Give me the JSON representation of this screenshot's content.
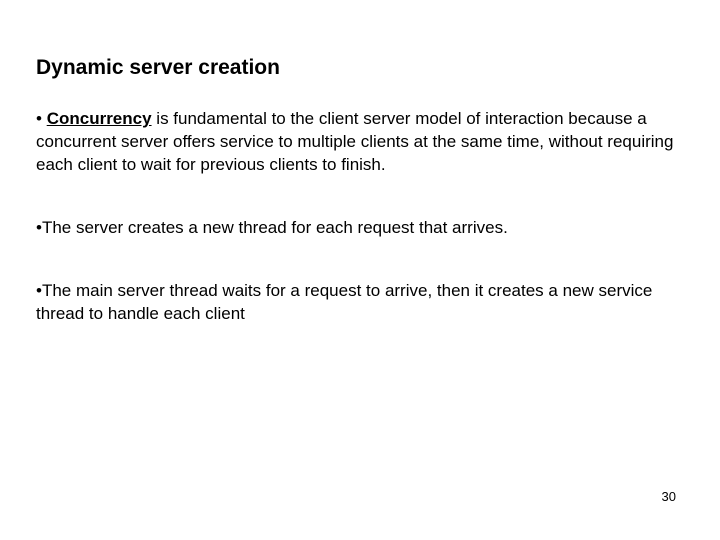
{
  "title": "Dynamic server creation",
  "bullets": [
    {
      "marker": "• ",
      "lead": "Concurrency",
      "text": " is fundamental to the client server model of interaction because a concurrent server offers service to multiple clients at the same time, without requiring each client to wait for previous clients to finish."
    },
    {
      "marker": "•",
      "lead": "",
      "text": "The server creates a new thread for each request that arrives."
    },
    {
      "marker": "•",
      "lead": "",
      "text": "The main  server thread waits for a request to arrive, then it creates a new service thread to handle each client"
    }
  ],
  "page_number": "30"
}
